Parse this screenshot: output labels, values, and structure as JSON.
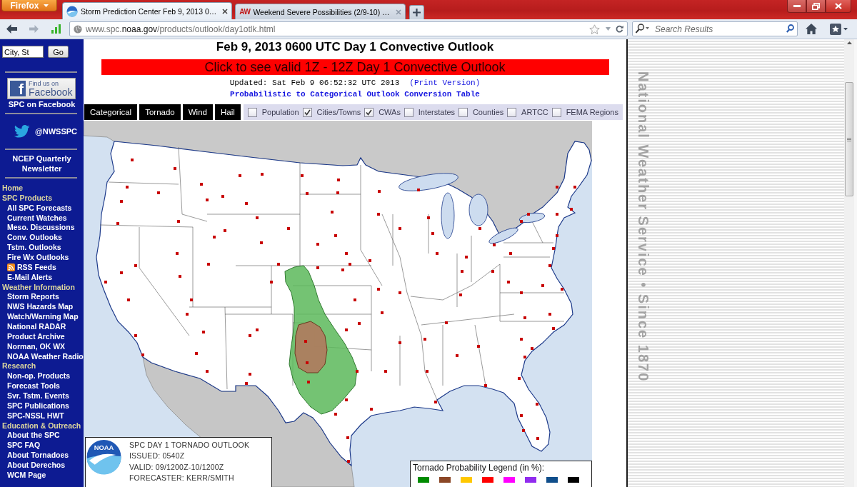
{
  "browser": {
    "menu_button": "Firefox",
    "tabs": [
      {
        "title": "Storm Prediction Center Feb 9, 2013 0…",
        "selected": true
      },
      {
        "title": "Weekend Severe Possibilities (2/9-10) …",
        "selected": false,
        "favicon_text": "AW"
      }
    ],
    "address": "www.spc.**noaa.gov**/products/outlook/day1otlk.html",
    "search": {
      "placeholder": "Search Results"
    }
  },
  "sidebar": {
    "location": {
      "value": "City, St",
      "button": "Go"
    },
    "facebook": {
      "logo_letter": "f",
      "badge_line": "Find us on",
      "badge_name": "Facebook",
      "link": "SPC on Facebook"
    },
    "twitter": "@NWSSPC",
    "newsletter": "NCEP Quarterly Newsletter",
    "nav": [
      {
        "label": "Home",
        "kind": "heading"
      },
      {
        "label": "SPC Products",
        "kind": "heading"
      },
      {
        "label": "All SPC Forecasts",
        "kind": "link"
      },
      {
        "label": "Current Watches",
        "kind": "link"
      },
      {
        "label": "Meso. Discussions",
        "kind": "link"
      },
      {
        "label": "Conv. Outlooks",
        "kind": "link"
      },
      {
        "label": "Tstm. Outlooks",
        "kind": "link"
      },
      {
        "label": "Fire Wx Outlooks",
        "kind": "link"
      },
      {
        "label": "RSS Feeds",
        "kind": "feed"
      },
      {
        "label": "E-Mail Alerts",
        "kind": "link"
      },
      {
        "label": "Weather Information",
        "kind": "heading"
      },
      {
        "label": "Storm Reports",
        "kind": "link"
      },
      {
        "label": "NWS Hazards Map",
        "kind": "link"
      },
      {
        "label": "Watch/Warning Map",
        "kind": "link"
      },
      {
        "label": "National RADAR",
        "kind": "link"
      },
      {
        "label": "Product Archive",
        "kind": "link"
      },
      {
        "label": "Norman, OK WX",
        "kind": "link"
      },
      {
        "label": "NOAA Weather Radio",
        "kind": "link"
      },
      {
        "label": "Research",
        "kind": "heading"
      },
      {
        "label": "Non-op. Products",
        "kind": "link"
      },
      {
        "label": "Forecast Tools",
        "kind": "link"
      },
      {
        "label": "Svr. Tstm. Events",
        "kind": "link"
      },
      {
        "label": "SPC Publications",
        "kind": "link"
      },
      {
        "label": "SPC-NSSL HWT",
        "kind": "link"
      },
      {
        "label": "Education & Outreach",
        "kind": "heading"
      },
      {
        "label": "About the SPC",
        "kind": "link"
      },
      {
        "label": "SPC FAQ",
        "kind": "link"
      },
      {
        "label": "About Tornadoes",
        "kind": "link"
      },
      {
        "label": "About Derechos",
        "kind": "link"
      },
      {
        "label": "WCM Page",
        "kind": "link"
      }
    ]
  },
  "outlook": {
    "title": "Feb 9, 2013 0600 UTC Day 1 Convective Outlook",
    "banner": "Click to see valid 1Z - 12Z Day 1 Convective Outlook",
    "updated": "Updated: Sat Feb 9 06:52:32 UTC 2013",
    "print_link": "(Print Version)",
    "conversion_link": "Probabilistic to Categorical Outlook Conversion Table",
    "tabs": [
      {
        "label": "Categorical"
      },
      {
        "label": "Tornado"
      },
      {
        "label": "Wind"
      },
      {
        "label": "Hail"
      }
    ],
    "layers": [
      {
        "label": "Population",
        "checked": false
      },
      {
        "label": "Cities/Towns",
        "checked": true
      },
      {
        "label": "CWAs",
        "checked": true
      },
      {
        "label": "Interstates",
        "checked": false
      },
      {
        "label": "Counties",
        "checked": false
      },
      {
        "label": "ARTCC",
        "checked": false
      },
      {
        "label": "FEMA Regions",
        "checked": false
      }
    ],
    "map": {
      "logo_text": "NOAA",
      "info": [
        "SPC DAY 1 TORNADO OUTLOOK",
        "ISSUED: 0540Z",
        "VALID: 09/1200Z-10/1200Z",
        "FORECASTER: KERR/SMITH"
      ],
      "legend": {
        "title": "Tornado Probability Legend (in %):",
        "swatches": [
          {
            "color": "#008b00"
          },
          {
            "color": "#8b4726"
          },
          {
            "color": "#ffc800"
          },
          {
            "color": "#ff0000"
          },
          {
            "color": "#ff00ff"
          },
          {
            "color": "#912cee"
          },
          {
            "color": "#104e8b"
          },
          {
            "color": "#000000"
          }
        ]
      }
    }
  },
  "side_banner": "National Weather Service • Since 1870"
}
